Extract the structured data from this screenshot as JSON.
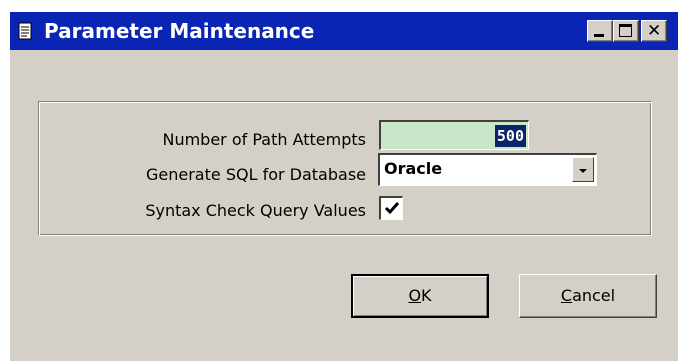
{
  "window": {
    "title": "Parameter Maintenance",
    "icon": "document-icon",
    "controls": {
      "minimize": "minimize-icon",
      "maximize": "maximize-icon",
      "close": "close-icon"
    }
  },
  "form": {
    "path_attempts": {
      "label": "Number of Path Attempts",
      "value": "500"
    },
    "database": {
      "label": "Generate SQL for Database",
      "value": "Oracle"
    },
    "syntax_check": {
      "label": "Syntax Check Query Values",
      "checked": true
    }
  },
  "buttons": {
    "ok": {
      "accel": "O",
      "rest": "K"
    },
    "cancel": {
      "accel": "C",
      "rest": "ancel"
    }
  },
  "colors": {
    "titlebar": "#0a24b4",
    "face": "#d4d0c8",
    "numeric_field_bg": "#c8e6c8",
    "selection": "#0a246a"
  }
}
